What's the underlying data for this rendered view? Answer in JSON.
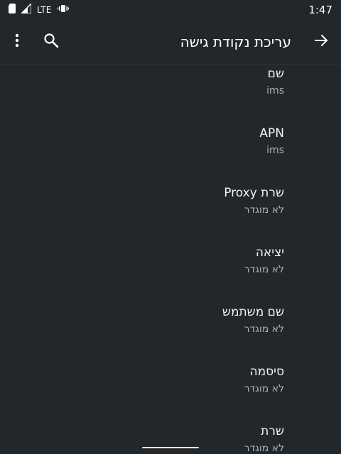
{
  "status_bar": {
    "network": "LTE",
    "time": "1:47"
  },
  "toolbar": {
    "title": "עריכת נקודת גישה",
    "back_icon": "arrow-back-icon",
    "search_icon": "search-icon",
    "menu_icon": "more-vert-icon"
  },
  "items": [
    {
      "title": "שם",
      "summary": "ims"
    },
    {
      "title": "APN",
      "summary": "ims"
    },
    {
      "title": "שרת Proxy",
      "summary": "לא מוגדר"
    },
    {
      "title": "יציאה",
      "summary": "לא מוגדר"
    },
    {
      "title": "שם משתמש",
      "summary": "לא מוגדר"
    },
    {
      "title": "סיסמה",
      "summary": "לא מוגדר"
    },
    {
      "title": "שרת",
      "summary": "לא מוגדר"
    }
  ],
  "colors": {
    "background": "#22272b",
    "text_primary": "#f1f3f4",
    "text_secondary": "#aab2b8"
  }
}
